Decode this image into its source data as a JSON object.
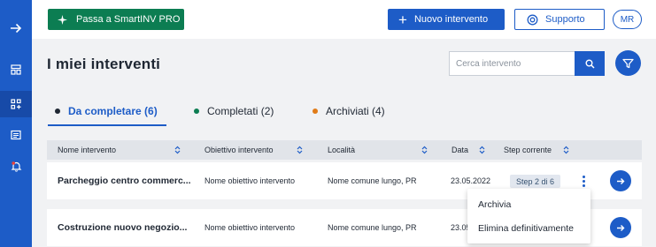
{
  "sidebar": {
    "items": [
      {
        "icon": "arrow-right-icon"
      },
      {
        "icon": "dashboard-icon"
      },
      {
        "icon": "interventions-icon"
      },
      {
        "icon": "news-icon"
      },
      {
        "icon": "notification-bell-icon"
      }
    ]
  },
  "topbar": {
    "pro_label": "Passa a SmartINV PRO",
    "new_label": "Nuovo intervento",
    "support_label": "Supporto",
    "avatar_initials": "MR"
  },
  "page": {
    "title": "I miei interventi",
    "search_placeholder": "Cerca intervento"
  },
  "tabs": [
    {
      "label": "Da completare (6)",
      "dot_color": "#1f2733",
      "active": true
    },
    {
      "label": "Completati (2)",
      "dot_color": "#0c7d52",
      "active": false
    },
    {
      "label": "Archiviati (4)",
      "dot_color": "#e07b18",
      "active": false
    }
  ],
  "table": {
    "columns": [
      "Nome intervento",
      "Obiettivo intervento",
      "Località",
      "Data",
      "Step corrente"
    ],
    "rows": [
      {
        "name": "Parcheggio centro commerc...",
        "goal": "Nome obiettivo intervento",
        "place": "Nome comune lungo, PR",
        "date": "23.05.2022",
        "step": "Step 2 di 6"
      },
      {
        "name": "Costruzione nuovo negozio...",
        "goal": "Nome obiettivo intervento",
        "place": "Nome comune lungo, PR",
        "date": "23.05.2022",
        "step": ""
      }
    ]
  },
  "context_menu": {
    "items": [
      "Archivia",
      "Elimina definitivamente"
    ]
  },
  "colors": {
    "primary": "#1d5cc7",
    "pro_green": "#0c7d52",
    "background": "#f1f2f4"
  }
}
